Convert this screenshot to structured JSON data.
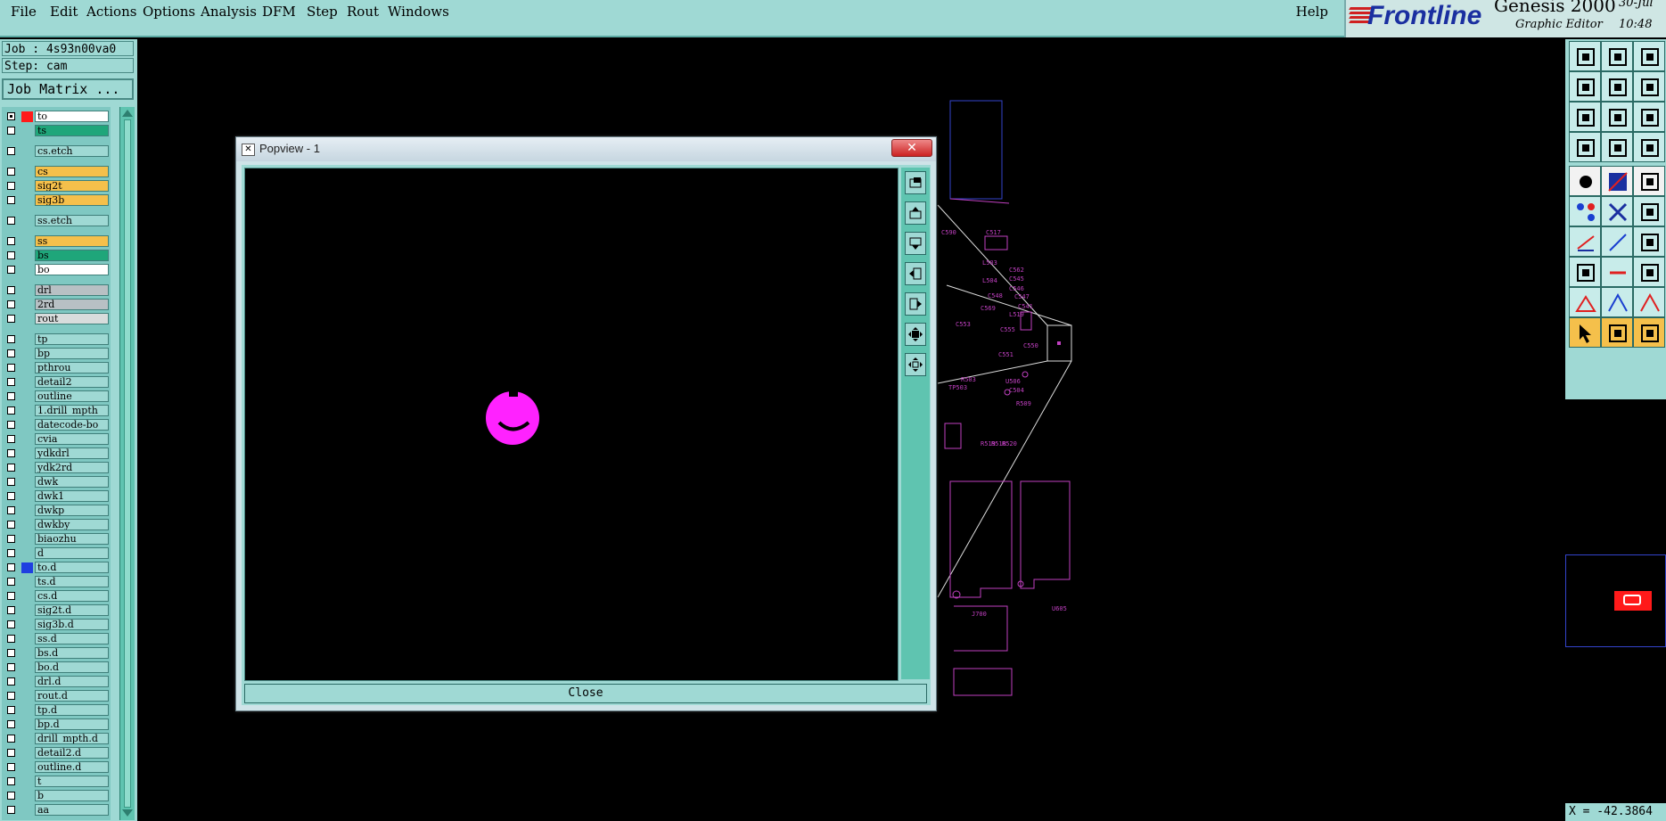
{
  "menubar": {
    "items": [
      {
        "label": "File"
      },
      {
        "label": "Edit"
      },
      {
        "label": "Actions"
      },
      {
        "label": "Options"
      },
      {
        "label": "Analysis"
      },
      {
        "label": "DFM"
      },
      {
        "label": "Step"
      },
      {
        "label": "Rout"
      },
      {
        "label": "Windows"
      }
    ],
    "help": "Help"
  },
  "brand": {
    "logo": "Frontline",
    "product": "Genesis 2000",
    "subtitle": "Graphic Editor",
    "date": "30-Jul",
    "time": "10:48"
  },
  "job": {
    "job_line": "Job : 4s93n00va0",
    "step_line": "Step: cam",
    "matrix_button": "Job Matrix ..."
  },
  "layers": [
    {
      "name": "to",
      "color": "#ffffff",
      "checked": true,
      "swatch": "#ff1a1a"
    },
    {
      "name": "ts",
      "color": "#1fa67a"
    },
    {
      "name": "cs.etch",
      "color": "#9fd9d4"
    },
    {
      "name": "cs",
      "color": "#f5c04b"
    },
    {
      "name": "sig2t",
      "color": "#f5c04b"
    },
    {
      "name": "sig3b",
      "color": "#f5c04b"
    },
    {
      "name": "ss.etch",
      "color": "#9fd9d4"
    },
    {
      "name": "ss",
      "color": "#f5c04b"
    },
    {
      "name": "bs",
      "color": "#1fa67a"
    },
    {
      "name": "bo",
      "color": "#ffffff"
    },
    {
      "name": "drl",
      "color": "#b8c0c4"
    },
    {
      "name": "2rd",
      "color": "#b8c0c4"
    },
    {
      "name": "rout",
      "color": "#d8dcdc"
    },
    {
      "name": "tp",
      "color": "#9fd9d4"
    },
    {
      "name": "bp",
      "color": "#9fd9d4"
    },
    {
      "name": "pthrou",
      "color": "#9fd9d4"
    },
    {
      "name": "detail2",
      "color": "#9fd9d4"
    },
    {
      "name": "outline",
      "color": "#9fd9d4"
    },
    {
      "name": "1.drill_mpth",
      "color": "#9fd9d4"
    },
    {
      "name": "datecode-bo",
      "color": "#9fd9d4"
    },
    {
      "name": "cvia",
      "color": "#9fd9d4"
    },
    {
      "name": "ydkdrl",
      "color": "#9fd9d4"
    },
    {
      "name": "ydk2rd",
      "color": "#9fd9d4"
    },
    {
      "name": "dwk",
      "color": "#9fd9d4"
    },
    {
      "name": "dwk1",
      "color": "#9fd9d4"
    },
    {
      "name": "dwkp",
      "color": "#9fd9d4"
    },
    {
      "name": "dwkby",
      "color": "#9fd9d4"
    },
    {
      "name": "biaozhu",
      "color": "#9fd9d4"
    },
    {
      "name": "d",
      "color": "#9fd9d4"
    },
    {
      "name": "to.d",
      "color": "#9fd9d4",
      "swatch": "#1f3fe0"
    },
    {
      "name": "ts.d",
      "color": "#9fd9d4"
    },
    {
      "name": "cs.d",
      "color": "#9fd9d4"
    },
    {
      "name": "sig2t.d",
      "color": "#9fd9d4"
    },
    {
      "name": "sig3b.d",
      "color": "#9fd9d4"
    },
    {
      "name": "ss.d",
      "color": "#9fd9d4"
    },
    {
      "name": "bs.d",
      "color": "#9fd9d4"
    },
    {
      "name": "bo.d",
      "color": "#9fd9d4"
    },
    {
      "name": "drl.d",
      "color": "#9fd9d4"
    },
    {
      "name": "rout.d",
      "color": "#9fd9d4"
    },
    {
      "name": "tp.d",
      "color": "#9fd9d4"
    },
    {
      "name": "bp.d",
      "color": "#9fd9d4"
    },
    {
      "name": "drill_mpth.d",
      "color": "#9fd9d4"
    },
    {
      "name": "detail2.d",
      "color": "#9fd9d4"
    },
    {
      "name": "outline.d",
      "color": "#9fd9d4"
    },
    {
      "name": "t",
      "color": "#9fd9d4"
    },
    {
      "name": "b",
      "color": "#9fd9d4"
    },
    {
      "name": "aa",
      "color": "#9fd9d4"
    }
  ],
  "popview": {
    "title": "Popview - 1",
    "close_label": "Close",
    "side_icons": [
      "zoom-home-icon",
      "move-up-icon",
      "move-down-icon",
      "move-left-icon",
      "move-right-icon",
      "zoom-in-icon",
      "zoom-out-icon"
    ]
  },
  "toolbar": {
    "icons": [
      "zoom-up-icon",
      "zoom-down-icon",
      "home-icon",
      "pan-left-icon",
      "pan-right-icon",
      "zoom-window-icon",
      "zoom-in-icon",
      "zoom-out-icon",
      "scale-1to2-icon",
      "settings-icon",
      "measure-icon",
      "snap-icon",
      "pad-icon",
      "layer-color-icon",
      "ruler-icon",
      "node-icon",
      "cross-icon",
      "point-icon",
      "line-red-icon",
      "line-blue-icon",
      "arc-icon",
      "corner-icon",
      "dash-icon",
      "bracket-icon",
      "triangle-icon",
      "triangle-blue-icon",
      "triangle-alt-icon",
      "select-arrow-icon",
      "select-box-icon",
      "select-extra-icon"
    ]
  },
  "canvas_labels": {
    "parts": [
      "C590",
      "C517",
      "L503",
      "C562",
      "C545",
      "L504",
      "C546",
      "C548",
      "C547",
      "C541",
      "C569",
      "L519",
      "C553",
      "C555",
      "C550",
      "C551",
      "U506",
      "C504",
      "R503",
      "TP503",
      "R509",
      "R519",
      "R518",
      "R520",
      "J700",
      "U605"
    ]
  },
  "status": {
    "coordinate": "X = -42.3864"
  }
}
